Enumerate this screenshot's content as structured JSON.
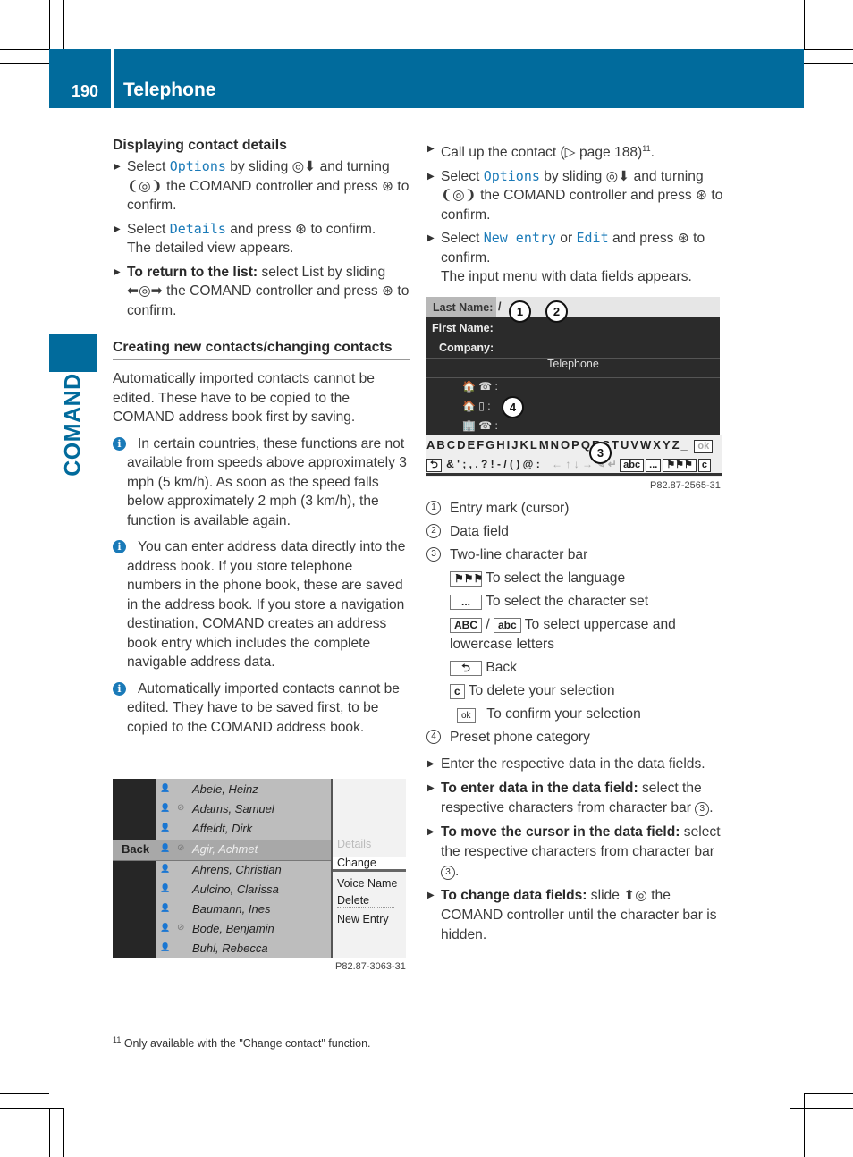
{
  "header": {
    "page_number": "190",
    "title": "Telephone",
    "side_tab": "COMAND",
    "brand_color": "#016b9c",
    "link_color": "#1a7ab8"
  },
  "left": {
    "section1": {
      "heading": "Displaying contact details",
      "steps": [
        {
          "pre": "Select ",
          "code": "Options",
          "post": " by sliding ◎⬇ and turning ❨◎❩ the COMAND controller and press ⊛ to confirm."
        },
        {
          "pre": "Select ",
          "code": "Details",
          "post": " and press ⊛ to confirm.",
          "result": "The detailed view appears."
        },
        {
          "bold": "To return to the list:",
          "post": " select List by sliding ⬅◎➡ the COMAND controller and press ⊛ to confirm."
        }
      ]
    },
    "section2": {
      "heading": "Creating new contacts/changing contacts",
      "para": "Automatically imported contacts cannot be edited. These have to be copied to the COMAND address book first by saving.",
      "info": [
        "In certain countries, these functions are not available from speeds above approximately 3 mph (5 km/h). As soon as the speed falls below approximately 2 mph (3 km/h), the function is available again.",
        "You can enter address data directly into the address book. If you store telephone numbers in the phone book, these are saved in the address book. If you store a navigation destination, COMAND creates an address book entry which includes the complete navigable address data.",
        "Automatically imported contacts cannot be edited. They have to be saved first, to be copied to the COMAND address book."
      ]
    },
    "figure1": {
      "contacts": [
        "Abele, Heinz",
        "Adams, Samuel",
        "Affeldt, Dirk",
        "Agir, Achmet",
        "Ahrens, Christian",
        "Aulcino, Clarissa",
        "Baumann, Ines",
        "Bode, Benjamin",
        "Buhl, Rebecca"
      ],
      "selected_contact": "Agir, Achmet",
      "back_label": "Back",
      "menu": [
        "Details",
        "Change",
        "Voice Name",
        "Delete",
        "New Entry"
      ],
      "code": "P82.87-3063-31"
    }
  },
  "right": {
    "steps_top": [
      {
        "text": "Call up the contact (▷ page 188)",
        "sup": "11",
        "tail": "."
      },
      {
        "pre": "Select ",
        "code": "Options",
        "post": " by sliding ◎⬇ and turning ❨◎❩ the COMAND controller and press ⊛ to confirm."
      },
      {
        "pre": "Select ",
        "code": "New entry",
        "mid": " or ",
        "code2": "Edit",
        "post": " and press ⊛ to confirm.",
        "result": "The input menu with data fields appears."
      }
    ],
    "figure2": {
      "fields": [
        "Last Name:",
        "First Name:",
        "Company:"
      ],
      "cursor": "/",
      "telephone_heading": "Telephone",
      "phone_rows": [
        "🏠 ☎ :",
        "🏠 ▯ :",
        "🏢 ☎ :"
      ],
      "char_line1": "ABCDEFGHIJKLMNOPQRSTUVWXYZ_",
      "char_highlight": "M",
      "char_ok": "ok",
      "char_line2": "& ' ; , . ? ! - / ( ) @ : _",
      "char_keys": [
        "abc",
        "...",
        "⚑⚑⚑",
        "c"
      ],
      "callouts": [
        "1",
        "2",
        "3",
        "4"
      ],
      "code": "P82.87-2565-31"
    },
    "legend": [
      {
        "num": "1",
        "text": "Entry mark (cursor)"
      },
      {
        "num": "2",
        "text": "Data field"
      },
      {
        "num": "3",
        "text": "Two-line character bar"
      }
    ],
    "legend_sub": [
      {
        "key": "⚑⚑⚑",
        "text": "To select the language"
      },
      {
        "key": "...",
        "text": "To select the character set"
      },
      {
        "key": "ABC",
        "key2": "abc",
        "text": "To select uppercase and lowercase letters"
      },
      {
        "key": "⮌",
        "text": "Back"
      },
      {
        "key": "c",
        "text": "To delete your selection"
      },
      {
        "key": "ok",
        "text": "To confirm your selection"
      }
    ],
    "legend4": {
      "num": "4",
      "text": "Preset phone category"
    },
    "steps_bottom": [
      {
        "text": "Enter the respective data in the data fields."
      },
      {
        "bold": "To enter data in the data field:",
        "post": " select the respective characters from character bar ",
        "num": "3",
        "tail": "."
      },
      {
        "bold": "To move the cursor in the data field:",
        "post": " select the respective characters from character bar ",
        "num": "3",
        "tail": "."
      },
      {
        "bold": "To change data fields:",
        "post": "  slide ⬆◎ the COMAND controller until the character bar is hidden."
      }
    ]
  },
  "footnote": {
    "num": "11",
    "text": " Only available with the \"Change contact\" function."
  }
}
